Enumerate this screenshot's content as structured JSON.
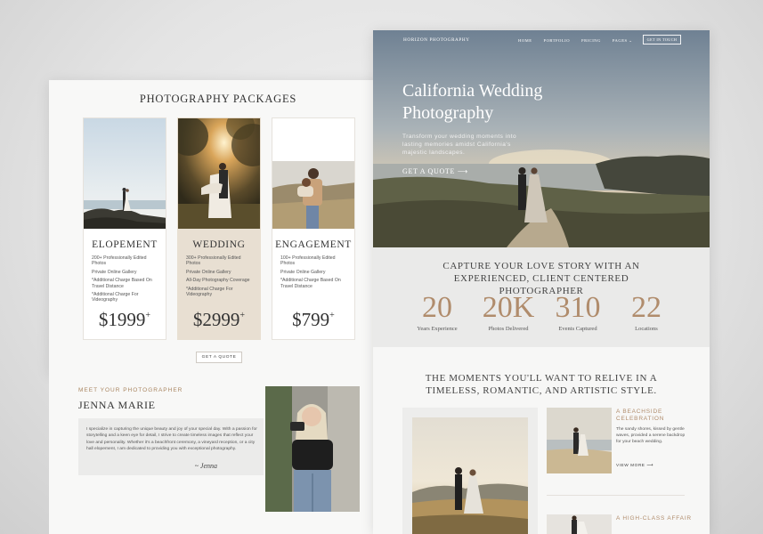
{
  "packages": {
    "title": "PHOTOGRAPHY PACKAGES",
    "items": [
      {
        "name": "ELOPEMENT",
        "features": [
          "200+ Professionally Edited Photos",
          "Private Online Gallery",
          "*Additional Charge Based On Travel Distance",
          "*Additional Charge For Videography"
        ],
        "price": "$1999",
        "price_sup": "+"
      },
      {
        "name": "WEDDING",
        "features": [
          "300+ Professionally Edited Photos",
          "Private Online Gallery",
          "All-Day Photography Coverage",
          "*Additional Charge For Videography"
        ],
        "price": "$2999",
        "price_sup": "+"
      },
      {
        "name": "ENGAGEMENT",
        "features": [
          "100+ Professionally Edited Photos",
          "Private Online Gallery",
          "*Additional Charge Based On Travel Distance"
        ],
        "price": "$799",
        "price_sup": "+"
      }
    ],
    "quote_button": "GET A QUOTE"
  },
  "bio": {
    "kicker": "MEET YOUR PHOTOGRAPHER",
    "name": "JENNA MARIE",
    "text": "I specialize in capturing the unique beauty and joy of your special day. With a passion for storytelling and a keen eye for detail, I strive to create timeless images that reflect your love and personality. Whether it's a beachfront ceremony, a vineyard reception, or a city hall elopement, I am dedicated to providing you with exceptional photography.",
    "signature": "~ Jenna"
  },
  "home": {
    "nav": {
      "logo": "HORIZON PHOTOGRAPHY",
      "links": [
        "HOME",
        "PORTFOLIO",
        "PRICING",
        "PAGES ⌄"
      ],
      "cta": "GET IN TOUCH"
    },
    "hero": {
      "title": "California Wedding Photography",
      "subtitle": "Transform your wedding moments into lasting memories amidst California's majestic landscapes.",
      "cta": "GET A QUOTE ⟶"
    },
    "stats": {
      "heading": "CAPTURE YOUR LOVE STORY WITH AN EXPERIENCED, CLIENT CENTERED PHOTOGRAPHER",
      "items": [
        {
          "value": "20",
          "label": "Years Experience"
        },
        {
          "value": "20K",
          "label": "Photos Delivered"
        },
        {
          "value": "310",
          "label": "Events Captured"
        },
        {
          "value": "22",
          "label": "Locations"
        }
      ]
    },
    "moments": {
      "title": "THE MOMENTS YOU'LL WANT TO RELIVE IN A TIMELESS, ROMANTIC, AND ARTISTIC STYLE.",
      "items": [
        {
          "tag": "A BEACHSIDE CELEBRATION",
          "description": "The sandy shores, kissed by gentle waves, provided a serene backdrop for your beach wedding.",
          "link": "VIEW MORE ⟶"
        },
        {
          "tag": "A HIGH-CLASS AFFAIR"
        }
      ]
    }
  },
  "colors": {
    "accent": "#b08c6c",
    "panel_bg": "#f8f8f7",
    "band_bg": "#eaeae9",
    "wedding_card": "#e8dfd2"
  }
}
